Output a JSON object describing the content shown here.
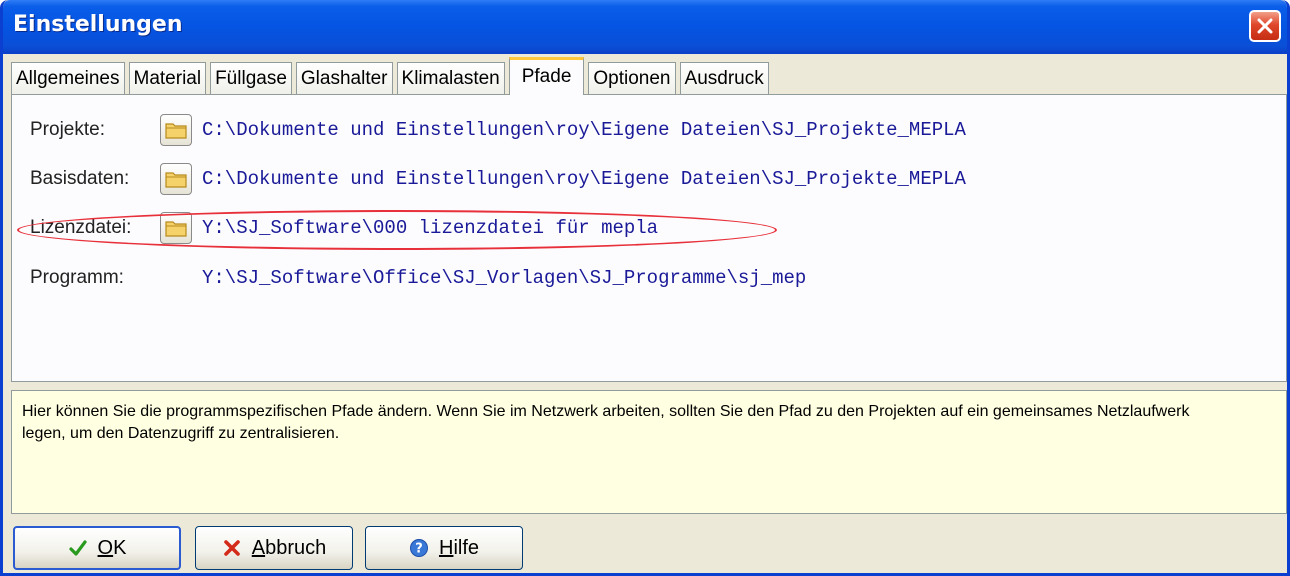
{
  "window": {
    "title": "Einstellungen"
  },
  "tabs": [
    {
      "label": "Allgemeines"
    },
    {
      "label": "Material"
    },
    {
      "label": "Füllgase"
    },
    {
      "label": "Glashalter"
    },
    {
      "label": "Klimalasten"
    },
    {
      "label": "Pfade"
    },
    {
      "label": "Optionen"
    },
    {
      "label": "Ausdruck"
    }
  ],
  "active_tab": "Pfade",
  "paths": {
    "projekte": {
      "label": "Projekte:",
      "value": "C:\\Dokumente und Einstellungen\\roy\\Eigene Dateien\\SJ_Projekte_MEPLA"
    },
    "basisdaten": {
      "label": "Basisdaten:",
      "value": "C:\\Dokumente und Einstellungen\\roy\\Eigene Dateien\\SJ_Projekte_MEPLA"
    },
    "lizenzdatei": {
      "label": "Lizenzdatei:",
      "value": "Y:\\SJ_Software\\000 lizenzdatei für mepla"
    },
    "programm": {
      "label": "Programm:",
      "value": "Y:\\SJ_Software\\Office\\SJ_Vorlagen\\SJ_Programme\\sj_mep"
    }
  },
  "help": {
    "line1": "Hier können Sie die programmspezifischen Pfade ändern. Wenn Sie im Netzwerk arbeiten, sollten Sie den Pfad zu den Projekten auf ein gemeinsames Netzlaufwerk",
    "line2": "legen, um den Datenzugriff zu zentralisieren."
  },
  "buttons": {
    "ok": {
      "accel": "O",
      "rest": "K"
    },
    "abbruch": {
      "accel": "A",
      "rest": "bbruch"
    },
    "hilfe": {
      "accel": "H",
      "rest": "ilfe"
    }
  },
  "colors": {
    "titlebar": "#0554e3",
    "path_text": "#1a1a99",
    "highlight": "#e8303a",
    "help_bg": "#ffffe1",
    "active_tab_accent": "#ffc83c"
  }
}
